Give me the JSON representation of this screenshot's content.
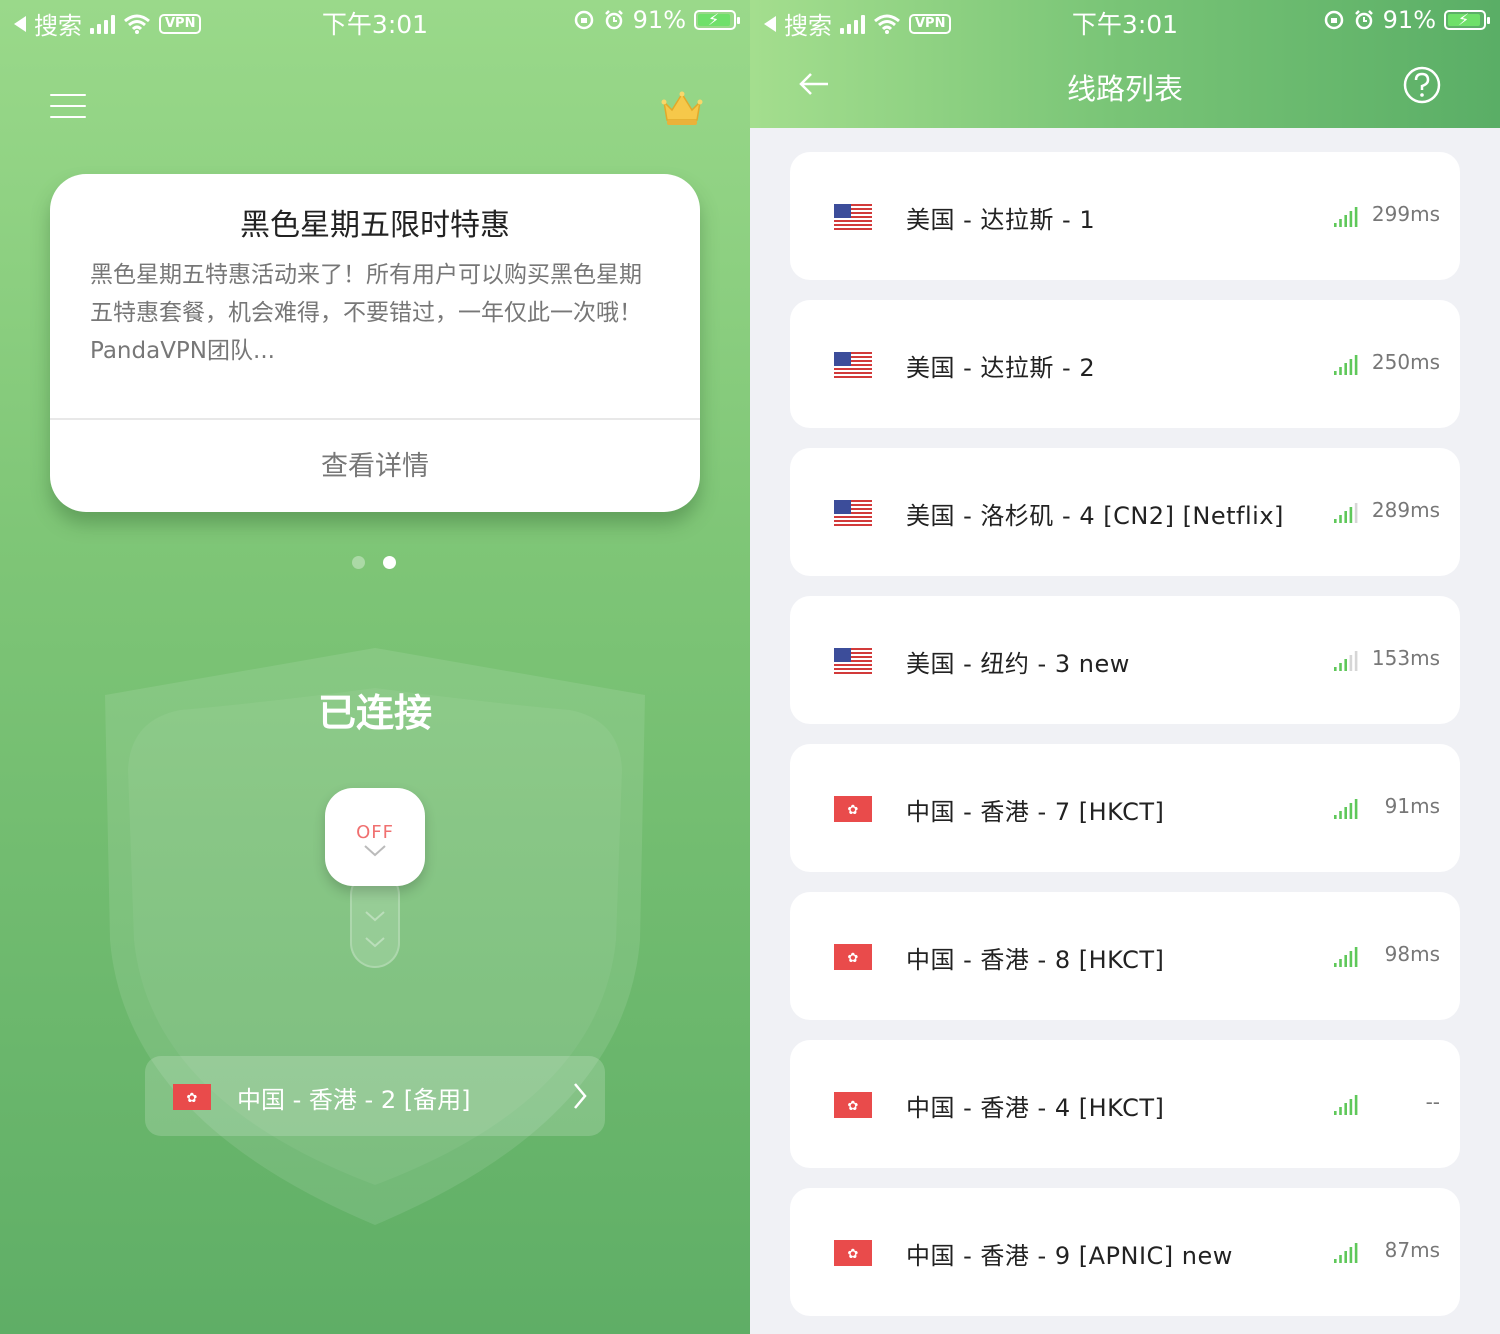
{
  "status_bar": {
    "back_app": "搜索",
    "vpn_badge": "VPN",
    "time": "下午3:01",
    "battery": "91%"
  },
  "left": {
    "promo": {
      "title": "黑色星期五限时特惠",
      "body": "黑色星期五特惠活动来了！所有用户可以购买黑色星期五特惠套餐，机会难得，不要错过，一年仅此一次哦！",
      "signature": "PandaVPN团队...",
      "details_button": "查看详情"
    },
    "connection_status": "已连接",
    "switch_label": "OFF",
    "current_server": "中国 - 香港 - 2 [备用]",
    "carousel": {
      "count": 2,
      "active_index": 1
    }
  },
  "right": {
    "title": "线路列表",
    "servers": [
      {
        "country": "us",
        "name": "美国 - 达拉斯 - 1",
        "latency": "299ms",
        "signal": 5
      },
      {
        "country": "us",
        "name": "美国 - 达拉斯 - 2",
        "latency": "250ms",
        "signal": 5
      },
      {
        "country": "us",
        "name": "美国 - 洛杉矶 - 4 [CN2] [Netflix]",
        "latency": "289ms",
        "signal": 4
      },
      {
        "country": "us",
        "name": "美国 - 纽约 - 3 new",
        "latency": "153ms",
        "signal": 3
      },
      {
        "country": "hk",
        "name": "中国 - 香港 - 7 [HKCT]",
        "latency": "91ms",
        "signal": 5
      },
      {
        "country": "hk",
        "name": "中国 - 香港 - 8 [HKCT]",
        "latency": "98ms",
        "signal": 5
      },
      {
        "country": "hk",
        "name": "中国 - 香港 - 4 [HKCT]",
        "latency": "--",
        "signal": 5
      },
      {
        "country": "hk",
        "name": "中国 - 香港 - 9 [APNIC] new",
        "latency": "87ms",
        "signal": 5
      }
    ]
  },
  "colors": {
    "signal_on": "#5fc85a",
    "signal_off": "#d6d6d6",
    "off_label": "#f07070",
    "flag_red": "#e94b4b"
  }
}
